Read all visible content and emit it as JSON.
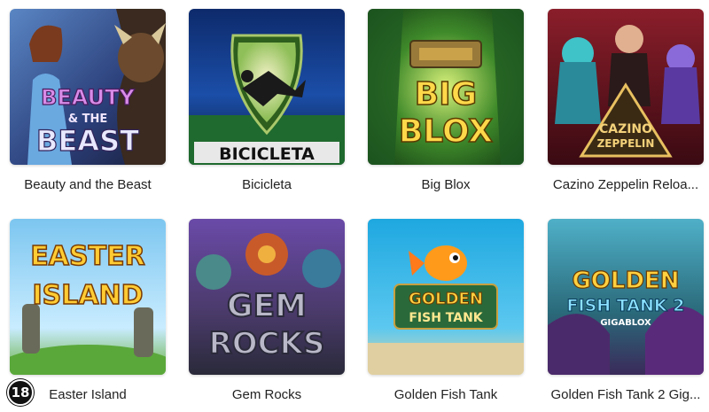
{
  "games": [
    {
      "title": "Beauty and the Beast",
      "logo_lines": [
        "BEAUTY",
        "& THE",
        "BEAST"
      ]
    },
    {
      "title": "Bicicleta",
      "logo_lines": [
        "BICICLETA"
      ]
    },
    {
      "title": "Big Blox",
      "logo_lines": [
        "BIG",
        "BLOX"
      ]
    },
    {
      "title": "Cazino Zeppelin Reloa...",
      "logo_lines": [
        "CAZINO",
        "ZEPPELIN"
      ]
    },
    {
      "title": "Easter Island",
      "logo_lines": [
        "EASTER",
        "ISLAND"
      ]
    },
    {
      "title": "Gem Rocks",
      "logo_lines": [
        "GEM",
        "ROCKS"
      ]
    },
    {
      "title": "Golden Fish Tank",
      "logo_lines": [
        "GOLDEN",
        "FISH TANK"
      ]
    },
    {
      "title": "Golden Fish Tank 2 Gig...",
      "logo_lines": [
        "GOLDEN",
        "FISH TANK 2",
        "GIGABLOX"
      ]
    }
  ],
  "age_badge": "18",
  "colors": {
    "label_text": "#222222",
    "background": "#ffffff"
  }
}
